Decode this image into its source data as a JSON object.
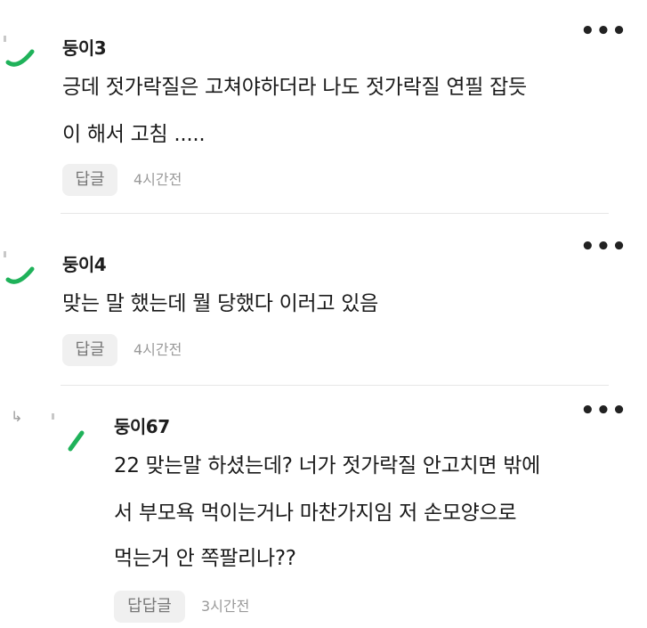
{
  "comments": [
    {
      "nick": "둥이3",
      "lines": [
        "긍데 젓가락질은 고쳐야하더라 나도 젓가락질 연필 잡듯",
        "이 해서 고침 ....."
      ],
      "reply_label": "답글",
      "time": "4시간전",
      "more": "•••"
    },
    {
      "nick": "둥이4",
      "lines": [
        "맞는 말 했는데 뭘 당했다 이러고 있음"
      ],
      "reply_label": "답글",
      "time": "4시간전",
      "more": "•••"
    },
    {
      "nick": "둥이67",
      "lines": [
        "22 맞는말 하셨는데? 너가 젓가락질 안고치면 밖에",
        "서 부모욕 먹이는거나 마찬가지임 저 손모양으로",
        "먹는거 안 쪽팔리나??"
      ],
      "reply_label": "답답글",
      "time": "3시간전",
      "more": "•••",
      "is_reply": true
    }
  ],
  "colors": {
    "avatar_accent": "#1fb25a",
    "divider": "#e6e6e6",
    "button_bg": "#f0f0f0"
  }
}
